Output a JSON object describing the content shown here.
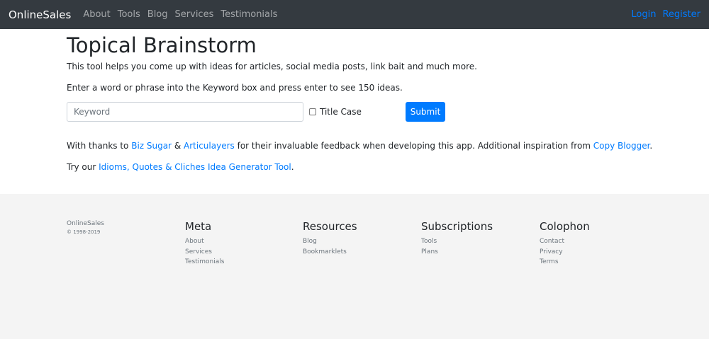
{
  "navbar": {
    "brand": "OnlineSales",
    "links": [
      "About",
      "Tools",
      "Blog",
      "Services",
      "Testimonials"
    ],
    "login": "Login",
    "register": "Register"
  },
  "main": {
    "title": "Topical Brainstorm",
    "intro": "This tool helps you come up with ideas for articles, social media posts, link bait and much more.",
    "instructions": "Enter a word or phrase into the Keyword box and press enter to see 150 ideas.",
    "form": {
      "keyword_placeholder": "Keyword",
      "keyword_value": "",
      "title_case_label": "Title Case",
      "title_case_checked": false,
      "submit_label": "Submit"
    },
    "thanks": {
      "prefix": "With thanks to ",
      "link1": "Biz Sugar",
      "amp": " & ",
      "link2": "Articulayers",
      "middle": " for their invaluable feedback when developing this app. Additional inspiration from ",
      "link3": "Copy Blogger",
      "suffix": "."
    },
    "try": {
      "prefix": "Try our ",
      "link": "Idioms, Quotes & Cliches Idea Generator Tool",
      "suffix": "."
    }
  },
  "footer": {
    "brand": "OnlineSales",
    "copyright": "© 1998-2019",
    "columns": [
      {
        "title": "Meta",
        "items": [
          "About",
          "Services",
          "Testimonials"
        ]
      },
      {
        "title": "Resources",
        "items": [
          "Blog",
          "Bookmarklets"
        ]
      },
      {
        "title": "Subscriptions",
        "items": [
          "Tools",
          "Plans"
        ]
      },
      {
        "title": "Colophon",
        "items": [
          "Contact",
          "Privacy",
          "Terms"
        ]
      }
    ]
  },
  "colors": {
    "navbar_bg": "#343a40",
    "accent": "#007bff",
    "footer_bg": "#f4f4f4"
  }
}
